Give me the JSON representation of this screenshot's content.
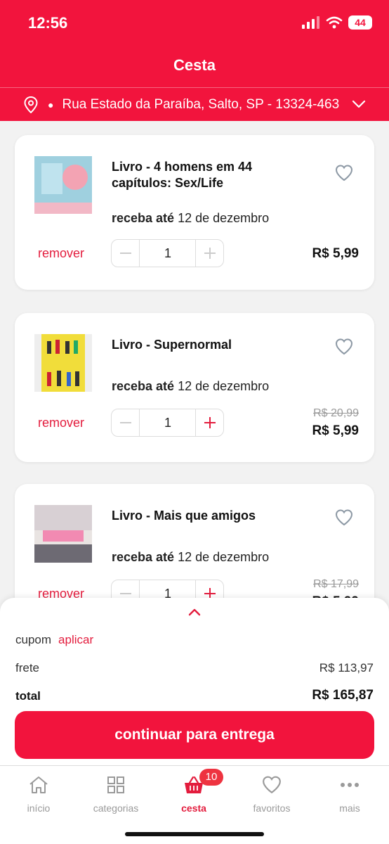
{
  "status": {
    "time": "12:56",
    "battery": "44"
  },
  "header": {
    "title": "Cesta"
  },
  "address": {
    "text": "Rua Estado da Paraíba, Salto, SP - 13324-463"
  },
  "items": [
    {
      "title": "Livro - 4 homens em 44 capítulos: Sex/Life",
      "delivery_prefix": "receba até",
      "delivery_date": "12 de dezembro",
      "remove_label": "remover",
      "quantity": "1",
      "old_price": "",
      "price": "R$ 5,99",
      "cover_text": "BB EASTON"
    },
    {
      "title": "Livro - Supernormal",
      "delivery_prefix": "receba até",
      "delivery_date": "12 de dezembro",
      "remove_label": "remover",
      "quantity": "1",
      "old_price": "R$ 20,99",
      "price": "R$ 5,99",
      "cover_text": "Supernormal"
    },
    {
      "title": "Livro - Mais que amigos",
      "delivery_prefix": "receba até",
      "delivery_date": "12 de dezembro",
      "remove_label": "remover",
      "quantity": "1",
      "old_price": "R$ 17,99",
      "price": "R$ 5,99",
      "cover_text": "MAIS QUE AMIGOS"
    }
  ],
  "summary": {
    "coupon_label": "cupom",
    "coupon_action": "aplicar",
    "shipping_label": "frete",
    "shipping_value": "R$ 113,97",
    "total_label": "total",
    "total_value": "R$ 165,87",
    "cta_label": "continuar para entrega"
  },
  "tabs": [
    {
      "label": "início",
      "icon": "home-icon"
    },
    {
      "label": "categorias",
      "icon": "grid-icon"
    },
    {
      "label": "cesta",
      "icon": "basket-icon"
    },
    {
      "label": "favoritos",
      "icon": "heart-icon"
    },
    {
      "label": "mais",
      "icon": "more-icon"
    }
  ],
  "cart_badge": "10",
  "colors": {
    "brand": "#f2143d",
    "accent_text": "#e31c3d"
  }
}
